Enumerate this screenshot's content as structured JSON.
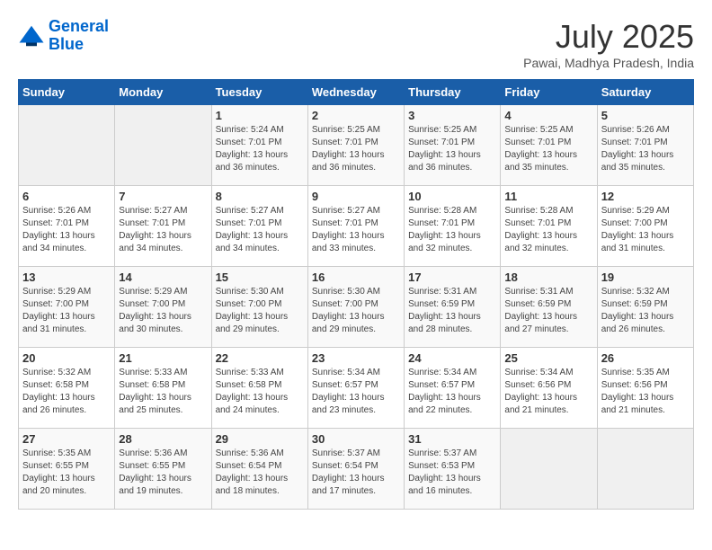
{
  "header": {
    "logo_line1": "General",
    "logo_line2": "Blue",
    "month_year": "July 2025",
    "location": "Pawai, Madhya Pradesh, India"
  },
  "days_of_week": [
    "Sunday",
    "Monday",
    "Tuesday",
    "Wednesday",
    "Thursday",
    "Friday",
    "Saturday"
  ],
  "weeks": [
    [
      {
        "day": "",
        "info": ""
      },
      {
        "day": "",
        "info": ""
      },
      {
        "day": "1",
        "info": "Sunrise: 5:24 AM\nSunset: 7:01 PM\nDaylight: 13 hours and 36 minutes."
      },
      {
        "day": "2",
        "info": "Sunrise: 5:25 AM\nSunset: 7:01 PM\nDaylight: 13 hours and 36 minutes."
      },
      {
        "day": "3",
        "info": "Sunrise: 5:25 AM\nSunset: 7:01 PM\nDaylight: 13 hours and 36 minutes."
      },
      {
        "day": "4",
        "info": "Sunrise: 5:25 AM\nSunset: 7:01 PM\nDaylight: 13 hours and 35 minutes."
      },
      {
        "day": "5",
        "info": "Sunrise: 5:26 AM\nSunset: 7:01 PM\nDaylight: 13 hours and 35 minutes."
      }
    ],
    [
      {
        "day": "6",
        "info": "Sunrise: 5:26 AM\nSunset: 7:01 PM\nDaylight: 13 hours and 34 minutes."
      },
      {
        "day": "7",
        "info": "Sunrise: 5:27 AM\nSunset: 7:01 PM\nDaylight: 13 hours and 34 minutes."
      },
      {
        "day": "8",
        "info": "Sunrise: 5:27 AM\nSunset: 7:01 PM\nDaylight: 13 hours and 34 minutes."
      },
      {
        "day": "9",
        "info": "Sunrise: 5:27 AM\nSunset: 7:01 PM\nDaylight: 13 hours and 33 minutes."
      },
      {
        "day": "10",
        "info": "Sunrise: 5:28 AM\nSunset: 7:01 PM\nDaylight: 13 hours and 32 minutes."
      },
      {
        "day": "11",
        "info": "Sunrise: 5:28 AM\nSunset: 7:01 PM\nDaylight: 13 hours and 32 minutes."
      },
      {
        "day": "12",
        "info": "Sunrise: 5:29 AM\nSunset: 7:00 PM\nDaylight: 13 hours and 31 minutes."
      }
    ],
    [
      {
        "day": "13",
        "info": "Sunrise: 5:29 AM\nSunset: 7:00 PM\nDaylight: 13 hours and 31 minutes."
      },
      {
        "day": "14",
        "info": "Sunrise: 5:29 AM\nSunset: 7:00 PM\nDaylight: 13 hours and 30 minutes."
      },
      {
        "day": "15",
        "info": "Sunrise: 5:30 AM\nSunset: 7:00 PM\nDaylight: 13 hours and 29 minutes."
      },
      {
        "day": "16",
        "info": "Sunrise: 5:30 AM\nSunset: 7:00 PM\nDaylight: 13 hours and 29 minutes."
      },
      {
        "day": "17",
        "info": "Sunrise: 5:31 AM\nSunset: 6:59 PM\nDaylight: 13 hours and 28 minutes."
      },
      {
        "day": "18",
        "info": "Sunrise: 5:31 AM\nSunset: 6:59 PM\nDaylight: 13 hours and 27 minutes."
      },
      {
        "day": "19",
        "info": "Sunrise: 5:32 AM\nSunset: 6:59 PM\nDaylight: 13 hours and 26 minutes."
      }
    ],
    [
      {
        "day": "20",
        "info": "Sunrise: 5:32 AM\nSunset: 6:58 PM\nDaylight: 13 hours and 26 minutes."
      },
      {
        "day": "21",
        "info": "Sunrise: 5:33 AM\nSunset: 6:58 PM\nDaylight: 13 hours and 25 minutes."
      },
      {
        "day": "22",
        "info": "Sunrise: 5:33 AM\nSunset: 6:58 PM\nDaylight: 13 hours and 24 minutes."
      },
      {
        "day": "23",
        "info": "Sunrise: 5:34 AM\nSunset: 6:57 PM\nDaylight: 13 hours and 23 minutes."
      },
      {
        "day": "24",
        "info": "Sunrise: 5:34 AM\nSunset: 6:57 PM\nDaylight: 13 hours and 22 minutes."
      },
      {
        "day": "25",
        "info": "Sunrise: 5:34 AM\nSunset: 6:56 PM\nDaylight: 13 hours and 21 minutes."
      },
      {
        "day": "26",
        "info": "Sunrise: 5:35 AM\nSunset: 6:56 PM\nDaylight: 13 hours and 21 minutes."
      }
    ],
    [
      {
        "day": "27",
        "info": "Sunrise: 5:35 AM\nSunset: 6:55 PM\nDaylight: 13 hours and 20 minutes."
      },
      {
        "day": "28",
        "info": "Sunrise: 5:36 AM\nSunset: 6:55 PM\nDaylight: 13 hours and 19 minutes."
      },
      {
        "day": "29",
        "info": "Sunrise: 5:36 AM\nSunset: 6:54 PM\nDaylight: 13 hours and 18 minutes."
      },
      {
        "day": "30",
        "info": "Sunrise: 5:37 AM\nSunset: 6:54 PM\nDaylight: 13 hours and 17 minutes."
      },
      {
        "day": "31",
        "info": "Sunrise: 5:37 AM\nSunset: 6:53 PM\nDaylight: 13 hours and 16 minutes."
      },
      {
        "day": "",
        "info": ""
      },
      {
        "day": "",
        "info": ""
      }
    ]
  ]
}
